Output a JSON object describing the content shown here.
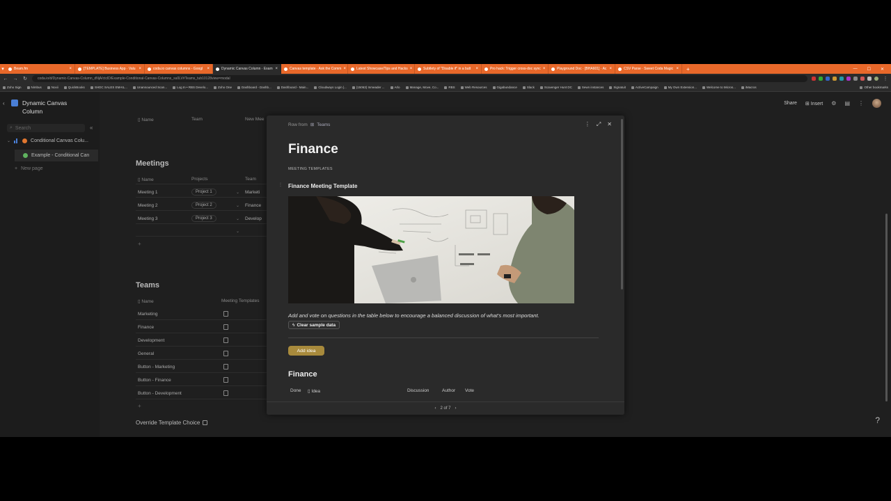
{
  "browser": {
    "tabs": [
      {
        "label": "Beam.fm",
        "active": false
      },
      {
        "label": "[TEMPLATE] Business App · Valu",
        "active": false
      },
      {
        "label": "coda.io canvas columns - Googl",
        "active": false
      },
      {
        "label": "Dynamic Canvas Column · Exam",
        "active": true
      },
      {
        "label": "Canvas template · Ask the Comm",
        "active": false
      },
      {
        "label": "Latest Showcase/Tips and Hacks",
        "active": false
      },
      {
        "label": "Subtlety of \"Disable if\" in a butt",
        "active": false
      },
      {
        "label": "Pro hack: Trigger cross-doc sync",
        "active": false
      },
      {
        "label": "Playground Doc · [BHA601] · Ac",
        "active": false
      },
      {
        "label": "CSV Parse · Sweet Coda Magic",
        "active": false
      }
    ],
    "url": "coda.io/d/Dynamic-Canvas-Column_dNjA/ctclD/Example-Conditional-Canvas-Columns_su0LV#Teams_tub10128view=modal",
    "bookmarks": [
      "Zoho Sign",
      "Nimbus",
      "Noxii",
      "QuickBooks",
      "SHDC SALES EMAIL...",
      "Unannounced Scan...",
      "Log In • RBS Develo...",
      "Zoho One",
      "Dashboard - Dashb...",
      "Dashboard - Main...",
      "Cloudways Login |...",
      "(15063) Inmeader ...",
      "Arlo",
      "Manage, Move, Co...",
      "RBS",
      "Web Resources",
      "Gigabundance",
      "Slack",
      "Scavenger Hunt DC",
      "Sewn instances",
      "Signatuit",
      "ActiveCampaign",
      "My Own Extension...",
      "Welcome to Micros...",
      "iMacros"
    ],
    "other_bookmarks": "Other bookmarks"
  },
  "sidebar": {
    "doc_title": "Dynamic Canvas Column",
    "search_placeholder": "Search",
    "pages": [
      {
        "label": "Conditional Canvas Colu...",
        "icon_color": "#e0762f"
      },
      {
        "label": "Example - Conditional Can",
        "icon_color": "#5fb35f"
      }
    ],
    "new_page": "New page"
  },
  "header": {
    "share": "Share",
    "insert": "Insert"
  },
  "canvas": {
    "top_cols": [
      "Name",
      "Team",
      "New Mee"
    ],
    "meetings": {
      "title": "Meetings",
      "cols": [
        "Name",
        "Projects",
        "Team"
      ],
      "rows": [
        {
          "name": "Meeting 1",
          "project": "Project 1",
          "team": "Marketi"
        },
        {
          "name": "Meeting 2",
          "project": "Project 2",
          "team": "Finance"
        },
        {
          "name": "Meeting 3",
          "project": "Project 3",
          "team": "Develop"
        }
      ]
    },
    "teams": {
      "title": "Teams",
      "cols": [
        "Name",
        "Meeting Templates"
      ],
      "rows": [
        "Marketing",
        "Finance",
        "Development",
        "General",
        "Button  - Marketing",
        "Button  - Finance",
        "Button  - Development"
      ]
    },
    "override_label": "Override Template Choice"
  },
  "modal": {
    "row_from": "Row from",
    "row_from_table": "Teams",
    "title": "Finance",
    "meeting_templates_label": "MEETING TEMPLATES",
    "template_title": "Finance Meeting Template",
    "description": "Add and vote on questions in the table below to encourage a balanced discussion of what's most important.",
    "clear_button": "Clear sample data",
    "add_button": "Add idea",
    "section_title": "Finance",
    "table_cols": [
      "Done",
      "Idea",
      "Discussion",
      "Author",
      "Vote"
    ],
    "pager": "2 of 7"
  },
  "colors": {
    "accent_orange": "#e8682a",
    "add_button": "#a88a3c",
    "modal_bg": "#2a2a2a",
    "app_bg": "#1f1f1f"
  }
}
